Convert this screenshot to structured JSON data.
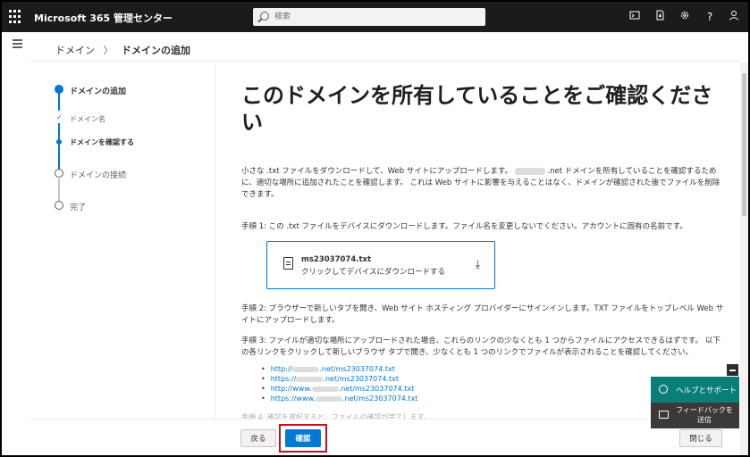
{
  "topbar": {
    "app_title": "Microsoft 365 管理センター",
    "search_placeholder": "検索",
    "icons": [
      "terminal-icon",
      "download-app-icon",
      "gear-icon",
      "help-icon",
      "user-icon"
    ],
    "help_glyph": "?"
  },
  "breadcrumb": {
    "parent": "ドメイン",
    "separator": "〉",
    "current": "ドメインの追加"
  },
  "steps": [
    {
      "label": "ドメインの追加",
      "state": "active"
    },
    {
      "label": "ドメイン名",
      "state": "complete",
      "check": "✓"
    },
    {
      "label": "ドメインを確認する",
      "state": "current"
    },
    {
      "label": "ドメインの接続",
      "state": "pending"
    },
    {
      "label": "完了",
      "state": "pending"
    }
  ],
  "main": {
    "title": "このドメインを所有していることをご確認ください",
    "intro_part1": "小さな .txt ファイルをダウンロードして、Web サイトにアップロードします。",
    "intro_part2": ".net ドメインを所有していることを確認するために、適切な場所に追加されたことを確認します。 これは Web サイトに影響を与えることはなく、ドメインが確認された後でファイルを削除できます。",
    "step1": "手順 1: この .txt ファイルをデバイスにダウンロードします。ファイル名を変更しないでください。アカウントに固有の名前です。",
    "download_card": {
      "file_name": "ms23037074.txt",
      "subtitle": "クリックしてデバイスにダウンロードする",
      "download_glyph": "⤓"
    },
    "step2": "手順 2: ブラウザーで新しいタブを開き、Web サイト ホスティング プロバイダーにサインインします。TXT ファイルをトップレベル Web サイトにアップロードします。",
    "step3": "手順 3: ファイルが適切な場所にアップロードされた場合、これらのリンクの少なくとも 1 つからファイルにアクセスできるはずです。 以下の各リンクをクリックして新しいブラウザ タブで開き、少なくとも 1 つのリンクでファイルが表示されることを確認してください。",
    "links": [
      {
        "prefix": "http://",
        "suffix": ".net/ms23037074.txt"
      },
      {
        "prefix": "https://",
        "suffix": ".net/ms23037074.txt"
      },
      {
        "prefix": "http://www.",
        "suffix": ".net/ms23037074.txt"
      },
      {
        "prefix": "https://www.",
        "suffix": ".net/ms23037074.txt"
      }
    ],
    "step4_partial": "手順 4: 確認を選択すると、ファイルの確認が完了します。"
  },
  "footer": {
    "back_label": "戻る",
    "confirm_label": "確認",
    "close_label": "閉じる"
  },
  "help_panel": {
    "help_label": "ヘルプとサポート",
    "feedback_label": "フィードバックを送信"
  },
  "colors": {
    "accent": "#0078d4",
    "topbar_bg": "#1b1b1b",
    "highlight": "#c50f1f",
    "help_bg": "#0a7f7a"
  }
}
